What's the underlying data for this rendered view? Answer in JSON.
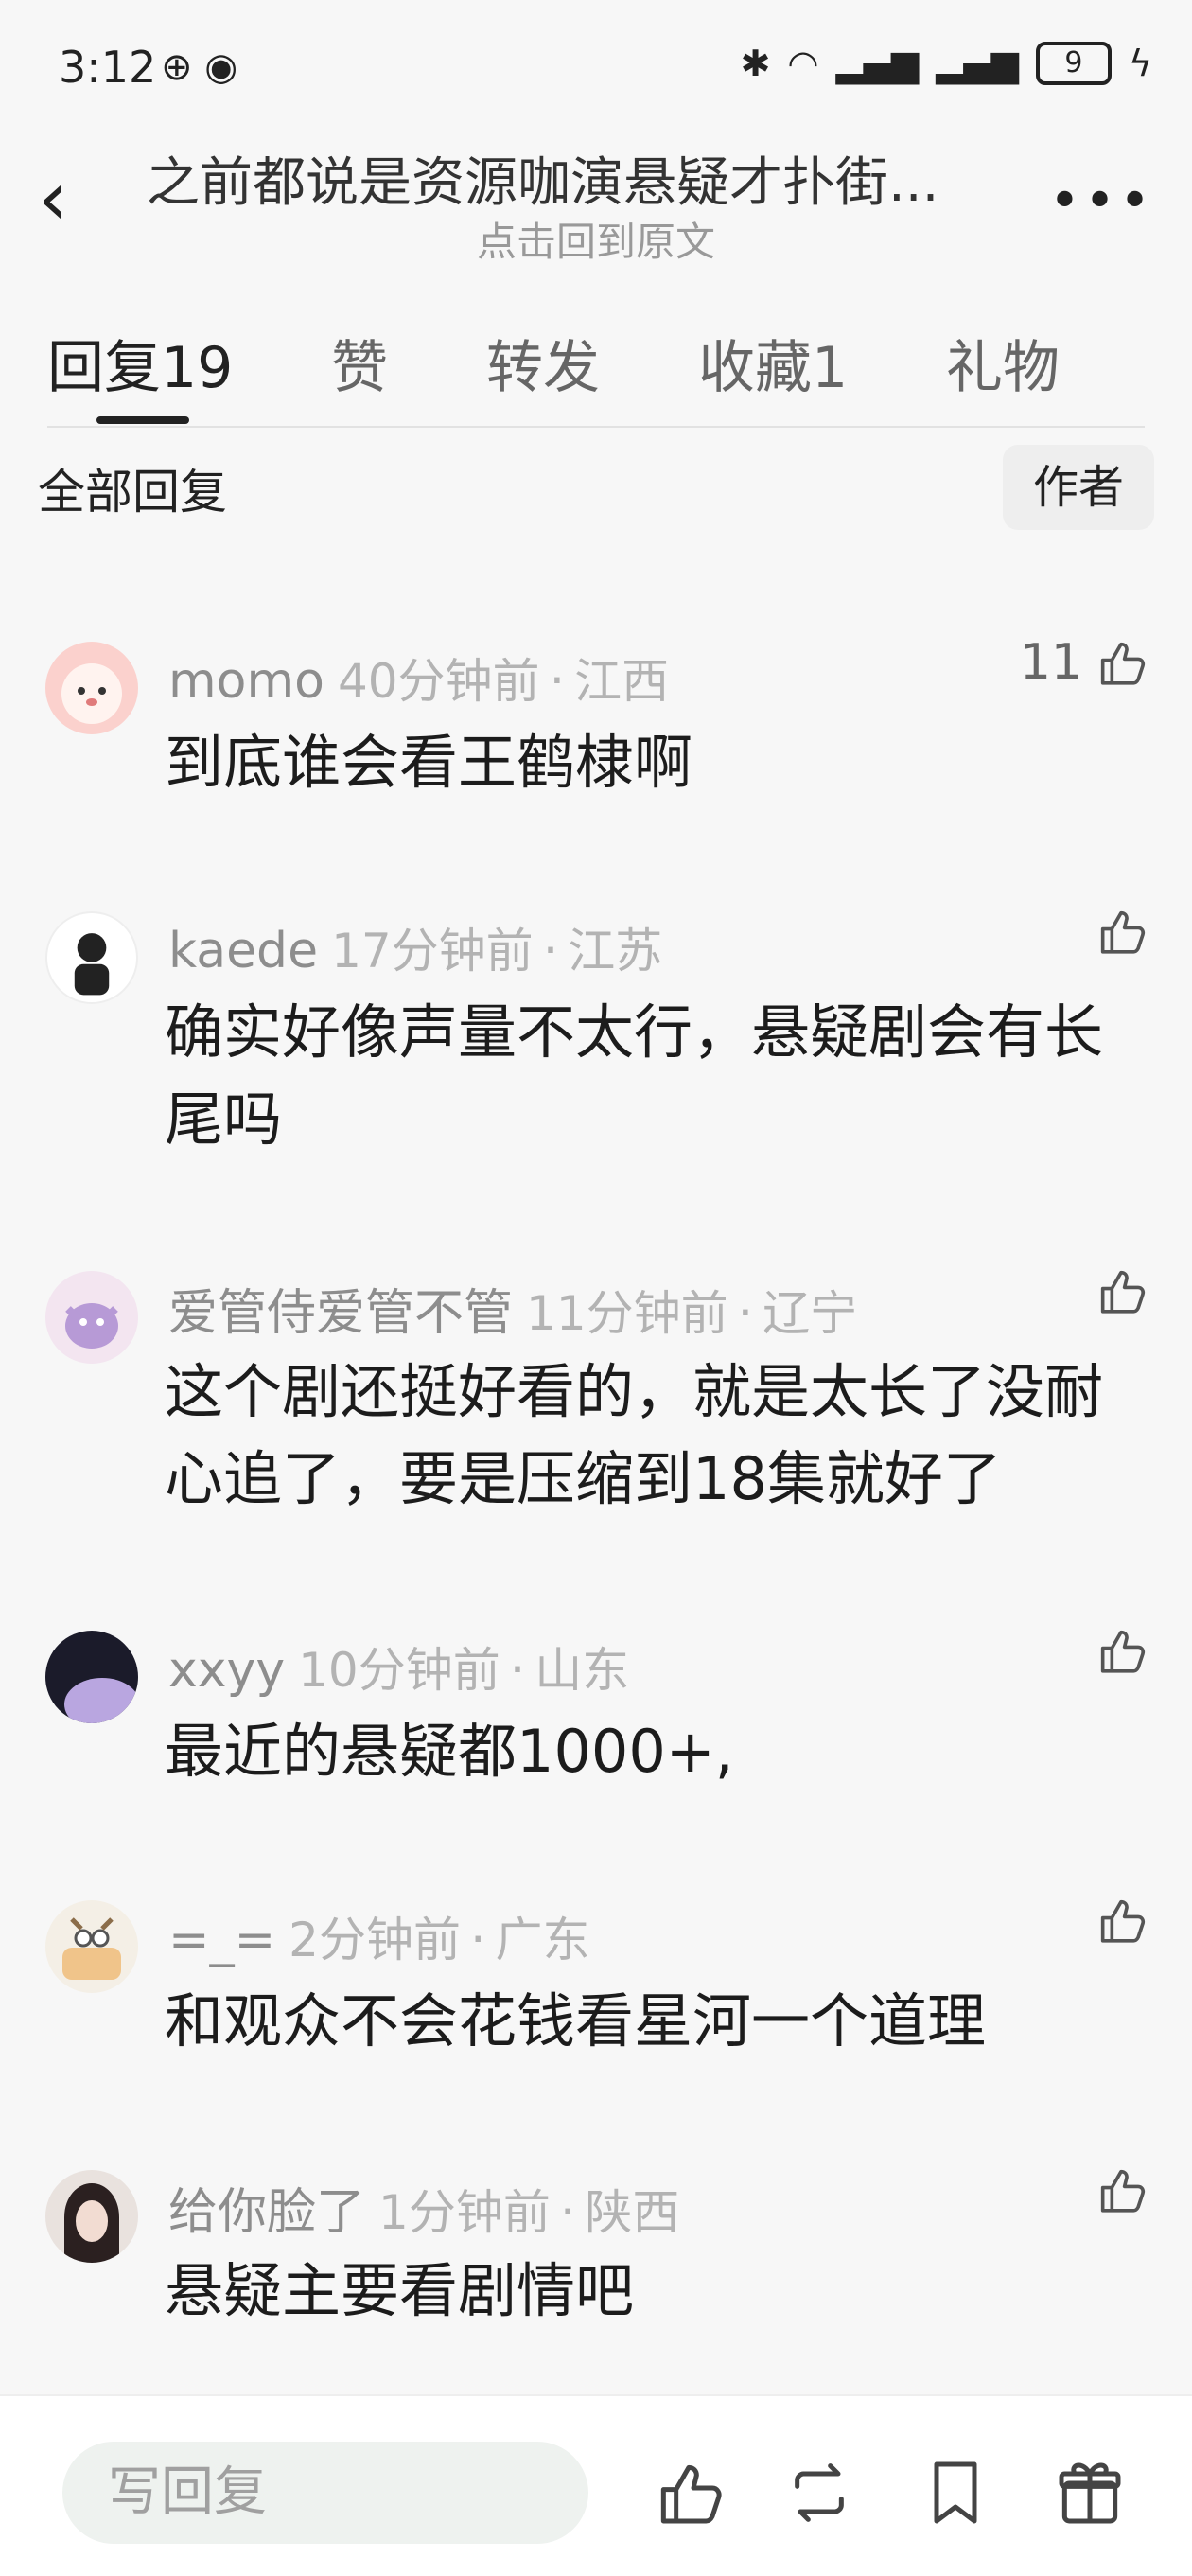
{
  "status_bar": {
    "time": "3:12",
    "battery": "9"
  },
  "header": {
    "title": "之前都说是资源咖演悬疑才扑街...",
    "subtitle": "点击回到原文",
    "more": "•••"
  },
  "tabs": [
    {
      "label": "回复",
      "count": "19"
    },
    {
      "label": "赞",
      "count": ""
    },
    {
      "label": "转发",
      "count": ""
    },
    {
      "label": "收藏",
      "count": "1"
    },
    {
      "label": "礼物",
      "count": ""
    }
  ],
  "filter": {
    "all": "全部回复",
    "author": "作者"
  },
  "comments": [
    {
      "name": "momo",
      "time": "40分钟前",
      "location": "江西",
      "text": "到底谁会看王鹤棣啊",
      "likes": "11"
    },
    {
      "name": "kaede",
      "time": "17分钟前",
      "location": "江苏",
      "text": "确实好像声量不太行，悬疑剧会有长尾吗",
      "likes": ""
    },
    {
      "name": "爱管侍爱管不管",
      "time": "11分钟前",
      "location": "辽宁",
      "text": "这个剧还挺好看的，就是太长了没耐心追了，要是压缩到18集就好了",
      "likes": ""
    },
    {
      "name": "xxyy",
      "time": "10分钟前",
      "location": "山东",
      "text": "最近的悬疑都1000+,",
      "likes": ""
    },
    {
      "name": "=_=",
      "time": "2分钟前",
      "location": "广东",
      "text": "和观众不会花钱看星河一个道理",
      "likes": ""
    },
    {
      "name": "给你脸了",
      "time": "1分钟前",
      "location": "陕西",
      "text": "悬疑主要看剧情吧",
      "likes": ""
    }
  ],
  "bottom_bar": {
    "reply_placeholder": "写回复"
  },
  "icons": [
    "back-icon",
    "more-icon",
    "like-icon",
    "repost-icon",
    "bookmark-icon",
    "gift-icon"
  ]
}
